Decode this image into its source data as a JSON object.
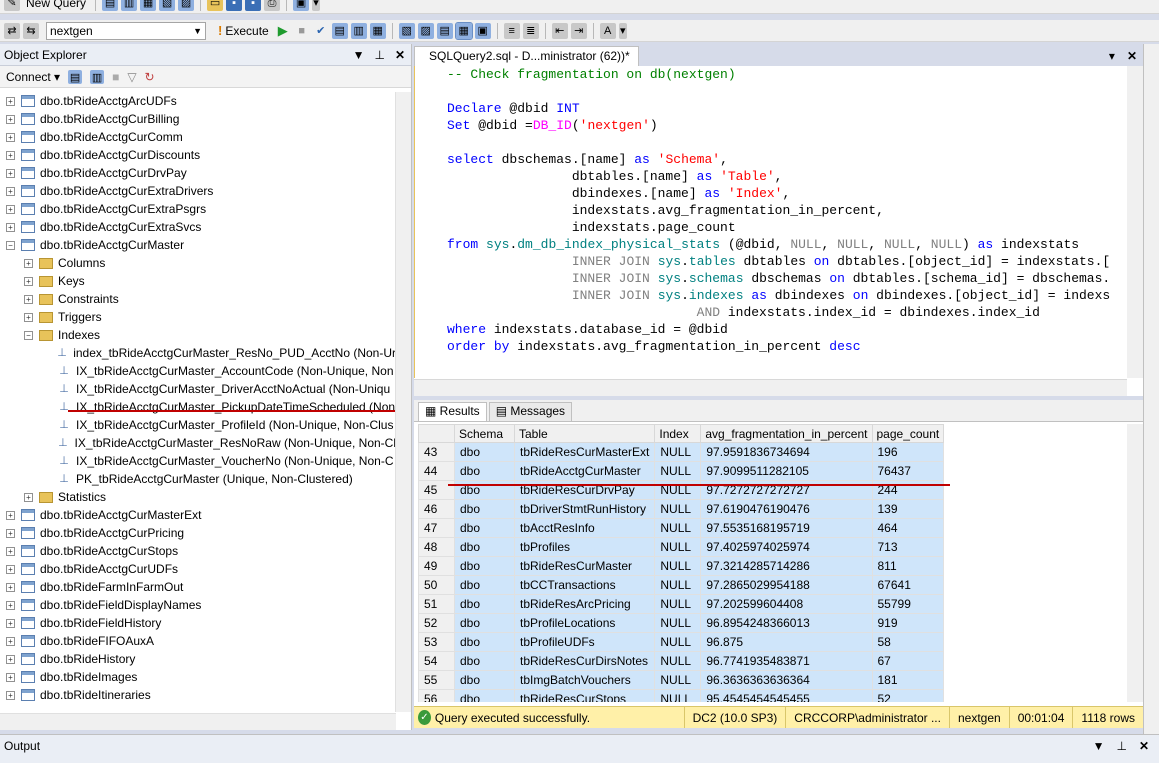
{
  "toolbar1": {
    "new_query": "New Query"
  },
  "toolbar2": {
    "database": "nextgen",
    "execute": "Execute"
  },
  "object_explorer": {
    "title": "Object Explorer",
    "connect": "Connect",
    "tree": [
      {
        "label": "dbo.tbRideAcctgArcUDFs",
        "type": "table",
        "indent": 0,
        "exp": "+"
      },
      {
        "label": "dbo.tbRideAcctgCurBilling",
        "type": "table",
        "indent": 0,
        "exp": "+"
      },
      {
        "label": "dbo.tbRideAcctgCurComm",
        "type": "table",
        "indent": 0,
        "exp": "+"
      },
      {
        "label": "dbo.tbRideAcctgCurDiscounts",
        "type": "table",
        "indent": 0,
        "exp": "+"
      },
      {
        "label": "dbo.tbRideAcctgCurDrvPay",
        "type": "table",
        "indent": 0,
        "exp": "+"
      },
      {
        "label": "dbo.tbRideAcctgCurExtraDrivers",
        "type": "table",
        "indent": 0,
        "exp": "+"
      },
      {
        "label": "dbo.tbRideAcctgCurExtraPsgrs",
        "type": "table",
        "indent": 0,
        "exp": "+"
      },
      {
        "label": "dbo.tbRideAcctgCurExtraSvcs",
        "type": "table",
        "indent": 0,
        "exp": "+"
      },
      {
        "label": "dbo.tbRideAcctgCurMaster",
        "type": "table",
        "indent": 0,
        "exp": "-"
      },
      {
        "label": "Columns",
        "type": "folder",
        "indent": 1,
        "exp": "+"
      },
      {
        "label": "Keys",
        "type": "folder",
        "indent": 1,
        "exp": "+"
      },
      {
        "label": "Constraints",
        "type": "folder",
        "indent": 1,
        "exp": "+"
      },
      {
        "label": "Triggers",
        "type": "folder",
        "indent": 1,
        "exp": "+"
      },
      {
        "label": "Indexes",
        "type": "folder",
        "indent": 1,
        "exp": "-"
      },
      {
        "label": "index_tbRideAcctgCurMaster_ResNo_PUD_AcctNo (Non-Ur",
        "type": "index",
        "indent": 2,
        "exp": ""
      },
      {
        "label": "IX_tbRideAcctgCurMaster_AccountCode (Non-Unique, Non",
        "type": "index",
        "indent": 2,
        "exp": ""
      },
      {
        "label": "IX_tbRideAcctgCurMaster_DriverAcctNoActual (Non-Uniqu",
        "type": "index",
        "indent": 2,
        "exp": ""
      },
      {
        "label": "IX_tbRideAcctgCurMaster_PickupDateTimeScheduled (Non",
        "type": "index",
        "indent": 2,
        "exp": ""
      },
      {
        "label": "IX_tbRideAcctgCurMaster_ProfileId (Non-Unique, Non-Clus",
        "type": "index",
        "indent": 2,
        "exp": ""
      },
      {
        "label": "IX_tbRideAcctgCurMaster_ResNoRaw (Non-Unique, Non-Cl",
        "type": "index",
        "indent": 2,
        "exp": ""
      },
      {
        "label": "IX_tbRideAcctgCurMaster_VoucherNo (Non-Unique, Non-C",
        "type": "index",
        "indent": 2,
        "exp": ""
      },
      {
        "label": "PK_tbRideAcctgCurMaster (Unique, Non-Clustered)",
        "type": "index",
        "indent": 2,
        "exp": ""
      },
      {
        "label": "Statistics",
        "type": "folder",
        "indent": 1,
        "exp": "+"
      },
      {
        "label": "dbo.tbRideAcctgCurMasterExt",
        "type": "table",
        "indent": 0,
        "exp": "+"
      },
      {
        "label": "dbo.tbRideAcctgCurPricing",
        "type": "table",
        "indent": 0,
        "exp": "+"
      },
      {
        "label": "dbo.tbRideAcctgCurStops",
        "type": "table",
        "indent": 0,
        "exp": "+"
      },
      {
        "label": "dbo.tbRideAcctgCurUDFs",
        "type": "table",
        "indent": 0,
        "exp": "+"
      },
      {
        "label": "dbo.tbRideFarmInFarmOut",
        "type": "table",
        "indent": 0,
        "exp": "+"
      },
      {
        "label": "dbo.tbRideFieldDisplayNames",
        "type": "table",
        "indent": 0,
        "exp": "+"
      },
      {
        "label": "dbo.tbRideFieldHistory",
        "type": "table",
        "indent": 0,
        "exp": "+"
      },
      {
        "label": "dbo.tbRideFIFOAuxA",
        "type": "table",
        "indent": 0,
        "exp": "+"
      },
      {
        "label": "dbo.tbRideHistory",
        "type": "table",
        "indent": 0,
        "exp": "+"
      },
      {
        "label": "dbo.tbRideImages",
        "type": "table",
        "indent": 0,
        "exp": "+"
      },
      {
        "label": "dbo.tbRideItineraries",
        "type": "table",
        "indent": 0,
        "exp": "+"
      }
    ]
  },
  "editor": {
    "tab_title": "SQLQuery2.sql - D...ministrator (62))*",
    "lines": [
      "-- Check fragmentation on db(nextgen)",
      "",
      "Declare @dbid INT",
      "Set @dbid =DB_ID('nextgen')",
      "",
      "select dbschemas.[name] as 'Schema',",
      "                dbtables.[name] as 'Table',",
      "                dbindexes.[name] as 'Index',",
      "                indexstats.avg_fragmentation_in_percent,",
      "                indexstats.page_count",
      "from sys.dm_db_index_physical_stats (@dbid, NULL, NULL, NULL, NULL) as indexstats",
      "                INNER JOIN sys.tables dbtables on dbtables.[object_id] = indexstats.[",
      "                INNER JOIN sys.schemas dbschemas on dbtables.[schema_id] = dbschemas.",
      "                INNER JOIN sys.indexes as dbindexes on dbindexes.[object_id] = indexs",
      "                                AND indexstats.index_id = dbindexes.index_id",
      "where indexstats.database_id = @dbid",
      "order by indexstats.avg_fragmentation_in_percent desc"
    ]
  },
  "results": {
    "tab_results": "Results",
    "tab_messages": "Messages",
    "columns": [
      "Schema",
      "Table",
      "Index",
      "avg_fragmentation_in_percent",
      "page_count"
    ],
    "rows": [
      [
        "43",
        "dbo",
        "tbRideResCurMasterExt",
        "NULL",
        "97.9591836734694",
        "196"
      ],
      [
        "44",
        "dbo",
        "tbRideAcctgCurMaster",
        "NULL",
        "97.9099511282105",
        "76437"
      ],
      [
        "45",
        "dbo",
        "tbRideResCurDrvPay",
        "NULL",
        "97.7272727272727",
        "244"
      ],
      [
        "46",
        "dbo",
        "tbDriverStmtRunHistory",
        "NULL",
        "97.6190476190476",
        "139"
      ],
      [
        "47",
        "dbo",
        "tbAcctResInfo",
        "NULL",
        "97.5535168195719",
        "464"
      ],
      [
        "48",
        "dbo",
        "tbProfiles",
        "NULL",
        "97.4025974025974",
        "713"
      ],
      [
        "49",
        "dbo",
        "tbRideResCurMaster",
        "NULL",
        "97.3214285714286",
        "811"
      ],
      [
        "50",
        "dbo",
        "tbCCTransactions",
        "NULL",
        "97.2865029954188",
        "67641"
      ],
      [
        "51",
        "dbo",
        "tbRideResArcPricing",
        "NULL",
        "97.202599604408",
        "55799"
      ],
      [
        "52",
        "dbo",
        "tbProfileLocations",
        "NULL",
        "96.8954248366013",
        "919"
      ],
      [
        "53",
        "dbo",
        "tbProfileUDFs",
        "NULL",
        "96.875",
        "58"
      ],
      [
        "54",
        "dbo",
        "tbRideResCurDirsNotes",
        "NULL",
        "96.7741935483871",
        "67"
      ],
      [
        "55",
        "dbo",
        "tbImgBatchVouchers",
        "NULL",
        "96.3636363636364",
        "181"
      ],
      [
        "56",
        "dbo",
        "tbRideResCurStops",
        "NULL",
        "95.4545454545455",
        "52"
      ]
    ]
  },
  "status": {
    "message": "Query executed successfully.",
    "server": "DC2 (10.0 SP3)",
    "user": "CRCCORP\\administrator ...",
    "database": "nextgen",
    "elapsed": "00:01:04",
    "rows": "1118 rows"
  },
  "output": {
    "title": "Output"
  }
}
